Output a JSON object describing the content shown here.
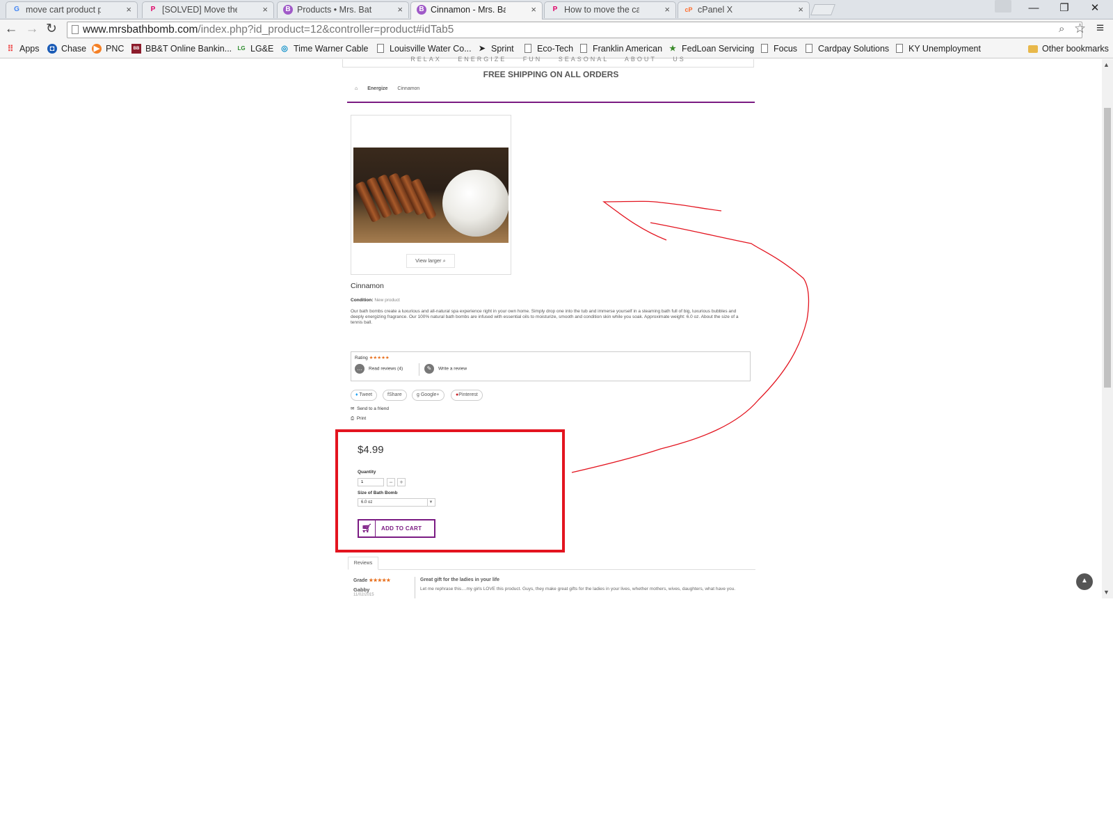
{
  "browser": {
    "tabs": [
      {
        "title": "move cart product page p",
        "favicon": "G",
        "favicon_color": "#4285f4",
        "active": false
      },
      {
        "title": "[SOLVED] Move the \"add t",
        "favicon": "P",
        "favicon_color": "#df0067",
        "active": false
      },
      {
        "title": "Products • Mrs. Bath Bom",
        "favicon": "B",
        "favicon_color": "#a05ac8",
        "active": false
      },
      {
        "title": "Cinnamon - Mrs. Bath Bor",
        "favicon": "B",
        "favicon_color": "#a05ac8",
        "active": true
      },
      {
        "title": "How to move the cart bloc",
        "favicon": "P",
        "favicon_color": "#df0067",
        "active": false
      },
      {
        "title": "cPanel X",
        "favicon": "cP",
        "favicon_color": "#ff6c2c",
        "active": false
      }
    ],
    "tab_close": "×",
    "window_buttons": {
      "minimize": "—",
      "restore": "❐",
      "close": "✕"
    },
    "url_host": "www.mrsbathbomb.com",
    "url_path": "/index.php?id_product=12&controller=product#idTab5",
    "bookmarks": [
      {
        "label": "Apps",
        "icon": "apps-icon"
      },
      {
        "label": "Chase",
        "icon": "chase-icon"
      },
      {
        "label": "PNC",
        "icon": "pnc-icon"
      },
      {
        "label": "BB&T Online Bankin...",
        "icon": "bbt-icon"
      },
      {
        "label": "LG&E",
        "icon": "lge-icon"
      },
      {
        "label": "Time Warner Cable",
        "icon": "twc-icon"
      },
      {
        "label": "Louisville Water Co...",
        "icon": "page-icon"
      },
      {
        "label": "Sprint",
        "icon": "sprint-icon"
      },
      {
        "label": "Eco-Tech",
        "icon": "page-icon"
      },
      {
        "label": "Franklin American",
        "icon": "page-icon"
      },
      {
        "label": "FedLoan Servicing",
        "icon": "fedloan-icon"
      },
      {
        "label": "Focus",
        "icon": "page-icon"
      },
      {
        "label": "Cardpay Solutions",
        "icon": "page-icon"
      },
      {
        "label": "KY Unemployment",
        "icon": "page-icon"
      }
    ],
    "other_bookmarks": "Other bookmarks"
  },
  "page": {
    "nav_items": "RELAX ENERGIZE FUN SEASONAL ABOUT US",
    "shipping_banner": "FREE SHIPPING ON ALL ORDERS",
    "breadcrumb": {
      "category": "Energize",
      "current": "Cinnamon"
    },
    "view_larger": "View larger",
    "product_name": "Cinnamon",
    "condition_label": "Condition:",
    "condition_value": "New product",
    "description": "Our bath bombs create a luxurious and all-natural spa experience right in your own home. Simply drop one into the tub and immerse yourself in a steaming bath full of big, luxurious bubbles and deeply energizing fragrance. Our 100% natural bath bombs are infused with essential oils to moisturize, smooth and condition skin while you soak. Approximate weight: 6.0 oz. About the size of a tennis ball.",
    "rating_label": "Rating",
    "rating_stars": "★★★★★",
    "read_reviews": "Read reviews (4)",
    "write_review": "Write a review",
    "share_buttons": {
      "tweet": "Tweet",
      "share": "Share",
      "google": "Google+",
      "pinterest": "Pinterest"
    },
    "send_to_friend": "Send to a friend",
    "print": "Print",
    "price": "$4.99",
    "quantity_label": "Quantity",
    "quantity_value": "1",
    "stepper_minus": "−",
    "stepper_plus": "+",
    "size_label": "Size of Bath Bomb",
    "size_value": "6.0 oz",
    "add_to_cart": "ADD TO CART",
    "reviews_tab": "Reviews",
    "review": {
      "grade_label": "Grade",
      "stars": "★★★★★",
      "author": "Gabby",
      "date": "11/02/2015",
      "title": "Great gift for the ladies in your life",
      "text": "Let me rephrase this....my girls LOVE this product. Guys, they make great gifts for the ladies in your lives, whether mothers, wives, daughters, what have you."
    }
  },
  "annotations": {
    "highlight_color": "#e3141f",
    "arrow_color": "#e3141f"
  }
}
